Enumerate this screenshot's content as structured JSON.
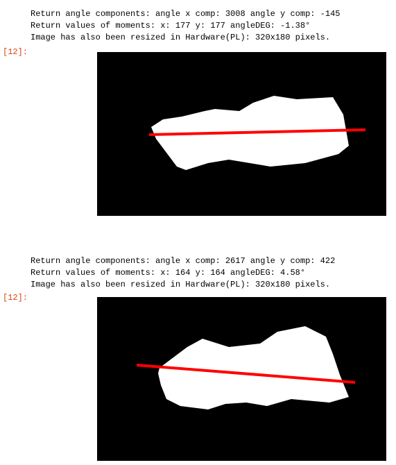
{
  "cells": [
    {
      "lines": [
        "Return angle components: angle x comp: 3008 angle y comp: -145",
        "Return values of moments: x: 177 y: 177 angleDEG: -1.38°",
        "Image has also been resized in Hardware(PL): 320x180 pixels."
      ],
      "prompt": "[12]:"
    },
    {
      "lines": [
        "Return angle components: angle x comp: 2617 angle y comp: 422",
        "Return values of moments: x: 164 y: 164 angleDEG: 4.58°",
        "Image has also been resized in Hardware(PL): 320x180 pixels."
      ],
      "prompt": "[12]:"
    }
  ],
  "colors": {
    "prompt": "#d84315",
    "line": "#ff0000",
    "blob": "#ffffff",
    "background": "#000000"
  }
}
